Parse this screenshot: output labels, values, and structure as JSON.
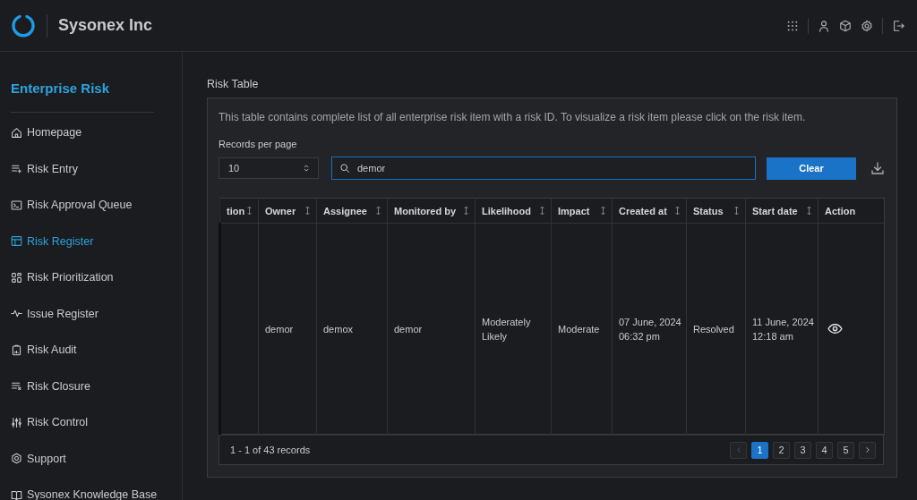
{
  "header": {
    "company": "Sysonex Inc"
  },
  "sidebar": {
    "title": "Enterprise Risk",
    "items": [
      {
        "label": "Homepage",
        "selected": false
      },
      {
        "label": "Risk Entry",
        "selected": false
      },
      {
        "label": "Risk Approval Queue",
        "selected": false
      },
      {
        "label": "Risk Register",
        "selected": true
      },
      {
        "label": "Risk Prioritization",
        "selected": false
      },
      {
        "label": "Issue Register",
        "selected": false
      },
      {
        "label": "Risk Audit",
        "selected": false
      },
      {
        "label": "Risk Closure",
        "selected": false
      },
      {
        "label": "Risk Control",
        "selected": false
      },
      {
        "label": "Support",
        "selected": false
      },
      {
        "label": "Sysonex Knowledge Base",
        "selected": false
      }
    ]
  },
  "section_title": "Risk Table",
  "table_panel": {
    "description": "This table contains complete list of all enterprise risk item with a risk ID. To visualize a risk item please click on the risk item.",
    "records_label": "Records per page",
    "records_value": "10",
    "search_value": "demor",
    "clear_button": "Clear",
    "columns": [
      {
        "label": "tion",
        "sortable": true
      },
      {
        "label": "Owner",
        "sortable": true
      },
      {
        "label": "Assignee",
        "sortable": true
      },
      {
        "label": "Monitored by",
        "sortable": true
      },
      {
        "label": "Likelihood",
        "sortable": true
      },
      {
        "label": "Impact",
        "sortable": true
      },
      {
        "label": "Created at",
        "sortable": true
      },
      {
        "label": "Status",
        "sortable": true
      },
      {
        "label": "Start date",
        "sortable": true
      },
      {
        "label": "Action",
        "sortable": false
      }
    ],
    "rows": [
      {
        "cells": [
          "",
          "demor",
          "demox",
          "demor",
          "Moderately Likely",
          "Moderate",
          "07 June, 2024 06:32 pm",
          "Resolved",
          "11 June, 2024 12:18 am"
        ]
      }
    ],
    "footer_text": "1 - 1 of 43 records",
    "pages": [
      {
        "label": "1",
        "selected": true
      },
      {
        "label": "2",
        "selected": false
      },
      {
        "label": "3",
        "selected": false
      },
      {
        "label": "4",
        "selected": false
      },
      {
        "label": "5",
        "selected": false
      }
    ]
  }
}
